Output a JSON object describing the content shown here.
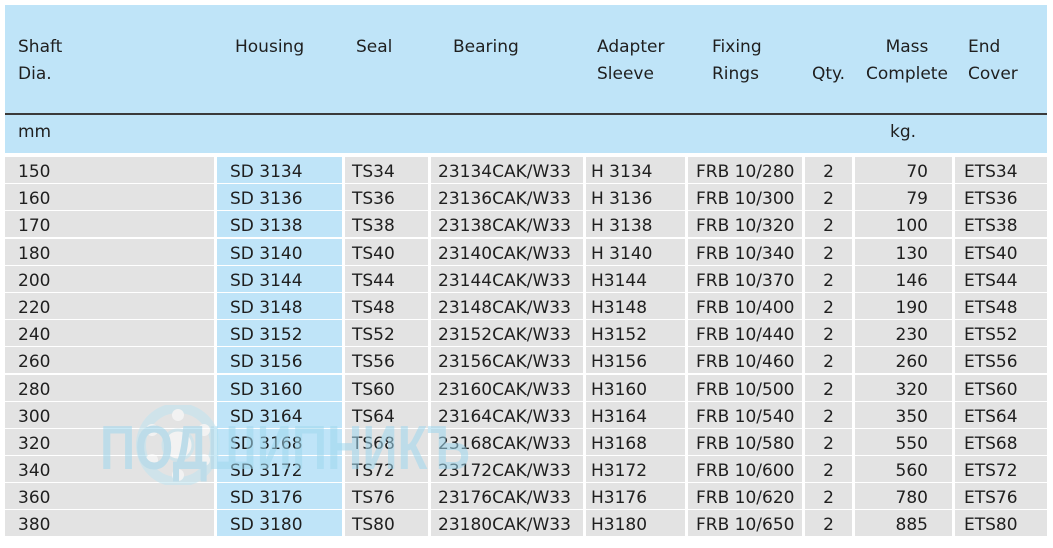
{
  "header": {
    "shaft": "Shaft\nDia.",
    "housing": "Housing",
    "seal": "Seal",
    "bearing": "Bearing",
    "sleeve": "Adapter\nSleeve",
    "rings": "Fixing\nRings",
    "qty": "Qty.",
    "mass": "Mass\nComplete",
    "cover": "End\nCover"
  },
  "units": {
    "shaft": "mm",
    "mass": "kg."
  },
  "rows": [
    {
      "shaft": "150",
      "housing": "SD 3134",
      "seal": "TS34",
      "bearing": "23134CAK/W33",
      "sleeve": "H 3134",
      "rings": "FRB 10/280",
      "qty": "2",
      "mass": "70",
      "cover": "ETS34"
    },
    {
      "shaft": "160",
      "housing": "SD 3136",
      "seal": "TS36",
      "bearing": "23136CAK/W33",
      "sleeve": "H 3136",
      "rings": "FRB 10/300",
      "qty": "2",
      "mass": "79",
      "cover": "ETS36"
    },
    {
      "shaft": "170",
      "housing": "SD 3138",
      "seal": "TS38",
      "bearing": "23138CAK/W33",
      "sleeve": "H 3138",
      "rings": "FRB 10/320",
      "qty": "2",
      "mass": "100",
      "cover": "ETS38"
    },
    {
      "shaft": "180",
      "housing": "SD 3140",
      "seal": "TS40",
      "bearing": "23140CAK/W33",
      "sleeve": "H 3140",
      "rings": "FRB 10/340",
      "qty": "2",
      "mass": "130",
      "cover": "ETS40"
    },
    {
      "shaft": "200",
      "housing": "SD 3144",
      "seal": "TS44",
      "bearing": "23144CAK/W33",
      "sleeve": "H3144",
      "rings": "FRB 10/370",
      "qty": "2",
      "mass": "146",
      "cover": "ETS44"
    },
    {
      "shaft": "220",
      "housing": "SD 3148",
      "seal": "TS48",
      "bearing": "23148CAK/W33",
      "sleeve": "H3148",
      "rings": "FRB 10/400",
      "qty": "2",
      "mass": "190",
      "cover": "ETS48"
    },
    {
      "shaft": "240",
      "housing": "SD 3152",
      "seal": "TS52",
      "bearing": "23152CAK/W33",
      "sleeve": "H3152",
      "rings": "FRB 10/440",
      "qty": "2",
      "mass": "230",
      "cover": "ETS52"
    },
    {
      "shaft": "260",
      "housing": "SD 3156",
      "seal": "TS56",
      "bearing": "23156CAK/W33",
      "sleeve": "H3156",
      "rings": "FRB 10/460",
      "qty": "2",
      "mass": "260",
      "cover": "ETS56"
    },
    {
      "shaft": "280",
      "housing": "SD 3160",
      "seal": "TS60",
      "bearing": "23160CAK/W33",
      "sleeve": "H3160",
      "rings": "FRB 10/500",
      "qty": "2",
      "mass": "320",
      "cover": "ETS60"
    },
    {
      "shaft": "300",
      "housing": "SD 3164",
      "seal": "TS64",
      "bearing": "23164CAK/W33",
      "sleeve": "H3164",
      "rings": "FRB 10/540",
      "qty": "2",
      "mass": "350",
      "cover": "ETS64"
    },
    {
      "shaft": "320",
      "housing": "SD 3168",
      "seal": "TS68",
      "bearing": "23168CAK/W33",
      "sleeve": "H3168",
      "rings": "FRB 10/580",
      "qty": "2",
      "mass": "550",
      "cover": "ETS68"
    },
    {
      "shaft": "340",
      "housing": "SD 3172",
      "seal": "TS72",
      "bearing": "23172CAK/W33",
      "sleeve": "H3172",
      "rings": "FRB 10/600",
      "qty": "2",
      "mass": "560",
      "cover": "ETS72"
    },
    {
      "shaft": "360",
      "housing": "SD 3176",
      "seal": "TS76",
      "bearing": "23176CAK/W33",
      "sleeve": "H3176",
      "rings": "FRB 10/620",
      "qty": "2",
      "mass": "780",
      "cover": "ETS76"
    },
    {
      "shaft": "380",
      "housing": "SD 3180",
      "seal": "TS80",
      "bearing": "23180CAK/W33",
      "sleeve": "H3180",
      "rings": "FRB 10/650",
      "qty": "2",
      "mass": "885",
      "cover": "ETS80"
    }
  ],
  "watermark": {
    "text": "ПОДШИПНИКЪ",
    "color": "#9fd8ee"
  },
  "colors": {
    "header_bg": "#bfe4f8",
    "row_bg": "#e3e3e3",
    "housing_bg": "#bfe4f8"
  }
}
